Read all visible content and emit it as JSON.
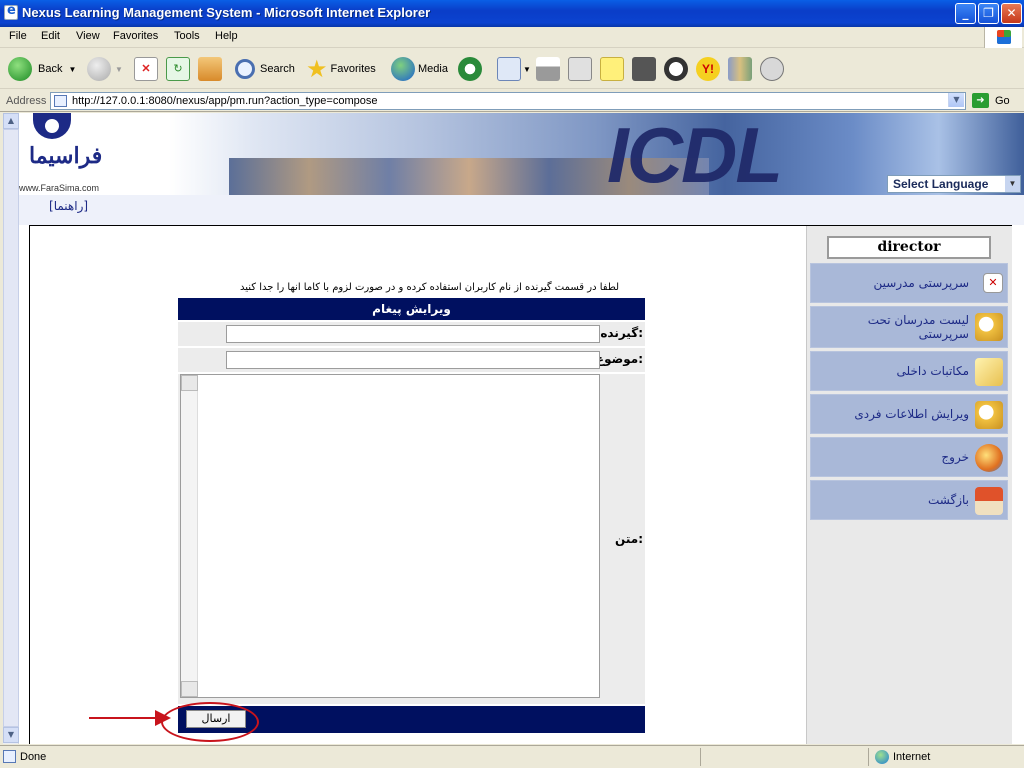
{
  "window": {
    "title": "Nexus Learning Management System - Microsoft Internet Explorer"
  },
  "menu": [
    "File",
    "Edit",
    "View",
    "Favorites",
    "Tools",
    "Help"
  ],
  "toolbar": {
    "back": "Back",
    "search": "Search",
    "favorites": "Favorites",
    "media": "Media"
  },
  "address": {
    "label": "Address",
    "url": "http://127.0.0.1:8080/nexus/app/pm.run?action_type=compose",
    "go": "Go"
  },
  "banner": {
    "logo_text": "فراسیما",
    "site": "www.FaraSima.com",
    "icdl": "ICDL",
    "language": "Select Language"
  },
  "help_link": "[راهنما]",
  "sidebar": {
    "user": "director",
    "items": [
      {
        "label": "سرپرستی مدرسین",
        "icon": "close-box-icon"
      },
      {
        "label": "لیست مدرسان تحت سرپرستی",
        "icon": "magnifier-icon"
      },
      {
        "label": "مکاتبات داخلی",
        "icon": "envelope-icon"
      },
      {
        "label": "ویرایش اطلاعات فردی",
        "icon": "magnifier-icon"
      },
      {
        "label": "خروج",
        "icon": "exit-globe-icon"
      },
      {
        "label": "بازگشت",
        "icon": "home-icon"
      }
    ]
  },
  "compose": {
    "instruction": "لطفا در قسمت گیرنده از نام کاربران استفاده کرده و در صورت لزوم با کاما انها را جدا کنید",
    "header": "ویرایش پیغام",
    "to_label": "گیرنده:",
    "to_value": "",
    "subject_label": "موضوع:",
    "subject_value": "",
    "body_label": "متن:",
    "body_value": "",
    "send_label": "ارسال"
  },
  "status": {
    "text": "Done",
    "zone": "Internet"
  }
}
